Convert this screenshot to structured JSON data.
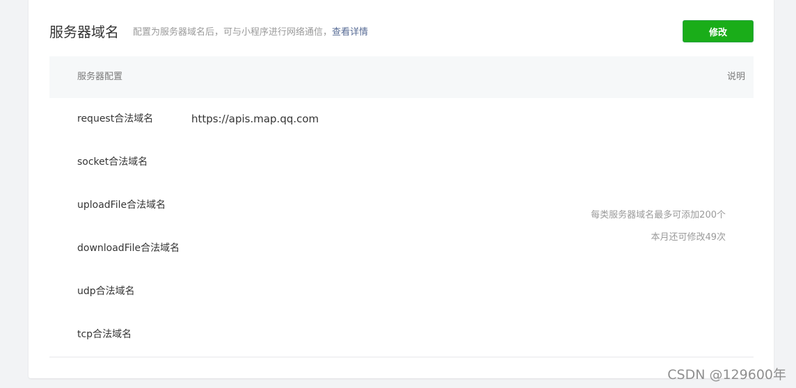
{
  "header": {
    "title": "服务器域名",
    "description": "配置为服务器域名后，可与小程序进行网络通信，",
    "detail_link": "查看详情",
    "edit_button": "修改"
  },
  "table": {
    "col_config": "服务器配置",
    "col_note": "说明",
    "rows": [
      {
        "label": "request合法域名",
        "value": "https://apis.map.qq.com"
      },
      {
        "label": "socket合法域名",
        "value": ""
      },
      {
        "label": "uploadFile合法域名",
        "value": ""
      },
      {
        "label": "downloadFile合法域名",
        "value": ""
      },
      {
        "label": "udp合法域名",
        "value": ""
      },
      {
        "label": "tcp合法域名",
        "value": ""
      }
    ],
    "notes": [
      "每类服务器域名最多可添加200个",
      "本月还可修改49次"
    ]
  },
  "watermark": "CSDN @129600年",
  "colors": {
    "accent_green": "#1aad19",
    "link": "#576b95"
  }
}
